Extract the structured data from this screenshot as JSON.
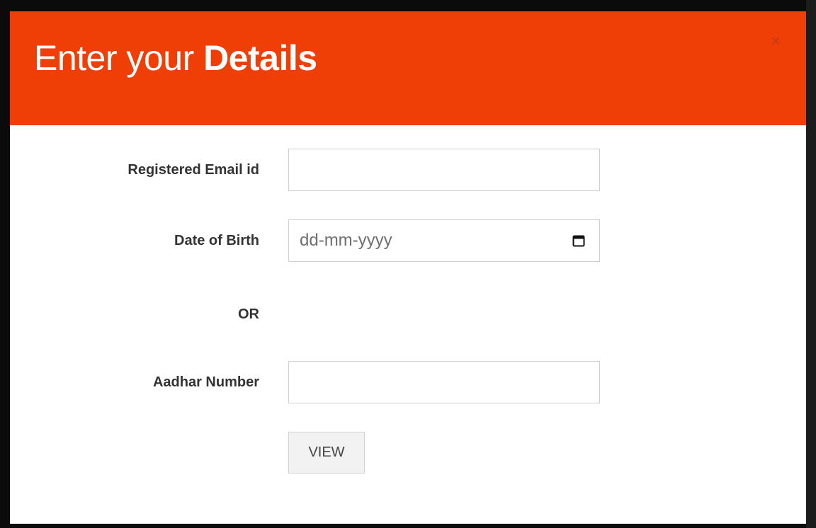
{
  "modal": {
    "title_light": "Enter your",
    "title_bold": "Details",
    "close_glyph": "×"
  },
  "form": {
    "email_label": "Registered Email id",
    "email_value": "",
    "dob_label": "Date of Birth",
    "dob_placeholder": "dd-mm-yyyy",
    "or_label": "OR",
    "aadhar_label": "Aadhar Number",
    "aadhar_value": "",
    "view_button": "VIEW"
  },
  "colors": {
    "header_accent": "#ef3e06",
    "backdrop": "#0b0b0b"
  },
  "icons": {
    "close": "close-icon",
    "calendar": "calendar-icon"
  }
}
